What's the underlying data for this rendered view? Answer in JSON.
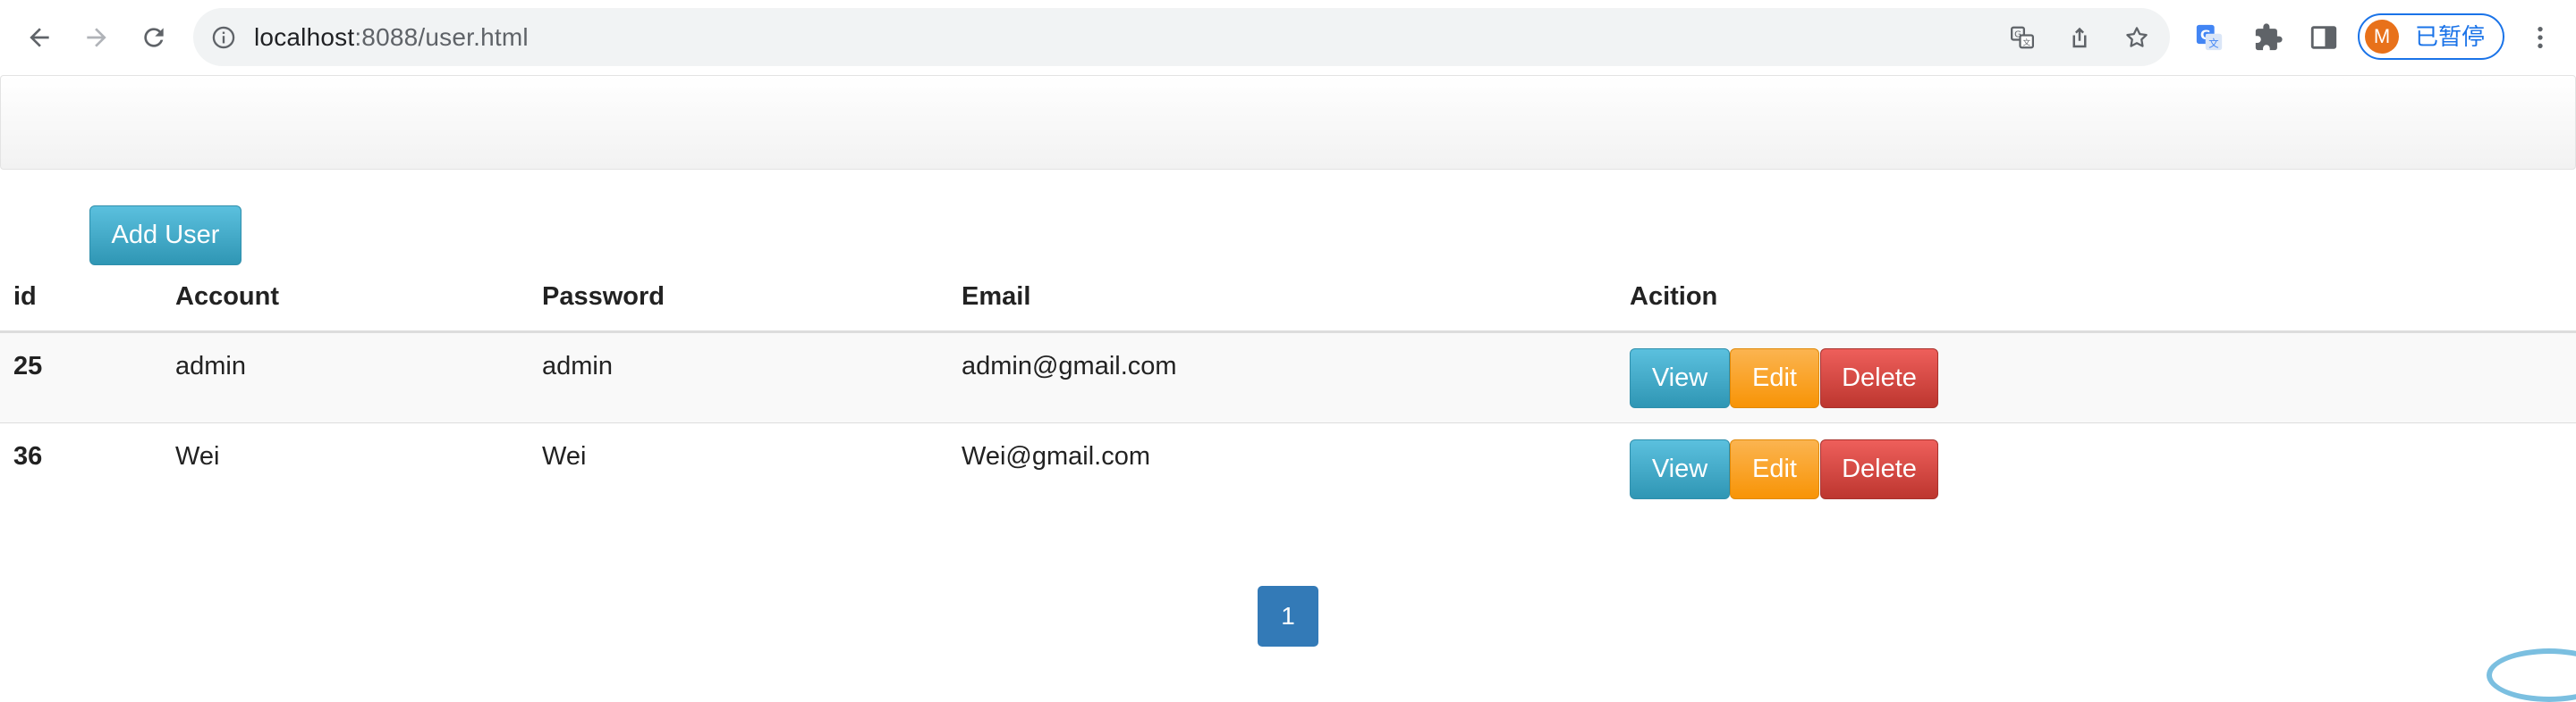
{
  "browser": {
    "url_host": "localhost",
    "url_path": ":8088/user.html",
    "profile_initial": "M",
    "profile_status": "已暂停",
    "icons": {
      "back": "arrow-left-icon",
      "forward": "arrow-right-icon",
      "reload": "reload-icon",
      "info": "info-icon",
      "translate": "translate-icon",
      "share": "share-icon",
      "bookmark": "star-icon",
      "google_translate": "google-translate-icon",
      "extensions": "puzzle-icon",
      "side_panel": "side-panel-icon",
      "menu": "kebab-menu-icon"
    }
  },
  "page": {
    "add_user_label": "Add User",
    "columns": [
      "id",
      "Account",
      "Password",
      "Email",
      "Acition"
    ],
    "rows": [
      {
        "id": "25",
        "account": "admin",
        "password": "admin",
        "email": "admin@gmail.com"
      },
      {
        "id": "36",
        "account": "Wei",
        "password": "Wei",
        "email": "Wei@gmail.com"
      }
    ],
    "actions": {
      "view": "View",
      "edit": "Edit",
      "delete": "Delete"
    },
    "pagination": {
      "current": "1"
    }
  },
  "colors": {
    "info": "#5bc0de",
    "warning": "#f89406",
    "danger": "#bd362f",
    "primary": "#337ab7"
  }
}
